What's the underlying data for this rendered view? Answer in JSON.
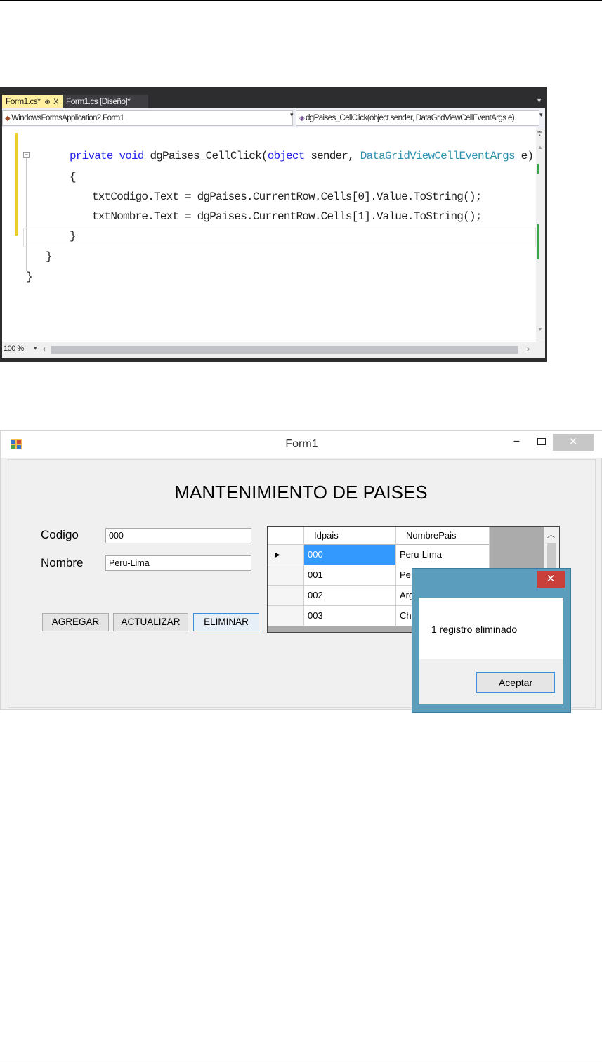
{
  "ide": {
    "tabs": [
      {
        "label": "Form1.cs*",
        "pin": "⊕",
        "close": "X"
      },
      {
        "label": "Form1.cs [Diseño]*"
      }
    ],
    "nav_left": "WindowsFormsApplication2.Form1",
    "nav_right": "dgPaises_CellClick(object sender, DataGridViewCellEventArgs e)",
    "code": {
      "line1": {
        "kw1": "private",
        "kw2": "void",
        "name": " dgPaises_CellClick(",
        "kw3": "object",
        "mid": " sender, ",
        "type": "DataGridViewCellEventArgs",
        "tail": " e)"
      },
      "line2": "{",
      "line3": "txtCodigo.Text = dgPaises.CurrentRow.Cells[0].Value.ToString();",
      "line4": "txtNombre.Text = dgPaises.CurrentRow.Cells[1].Value.ToString();",
      "line5": "}",
      "line6": "}",
      "line7": "}"
    },
    "zoom": "100 %"
  },
  "form": {
    "title": "Form1",
    "heading": "MANTENIMIENTO DE PAISES",
    "codigo_label": "Codigo",
    "codigo_value": "000",
    "nombre_label": "Nombre",
    "nombre_value": "Peru-Lima",
    "buttons": {
      "agregar": "AGREGAR",
      "actualizar": "ACTUALIZAR",
      "eliminar": "ELIMINAR"
    },
    "grid": {
      "columns": [
        "Idpais",
        "NombrePais"
      ],
      "rows": [
        [
          "000",
          "Peru-Lima"
        ],
        [
          "001",
          "Pe"
        ],
        [
          "002",
          "Arg"
        ],
        [
          "003",
          "Ch"
        ]
      ]
    }
  },
  "messagebox": {
    "close": "✕",
    "text": "1 registro eliminado",
    "ok": "Aceptar"
  }
}
